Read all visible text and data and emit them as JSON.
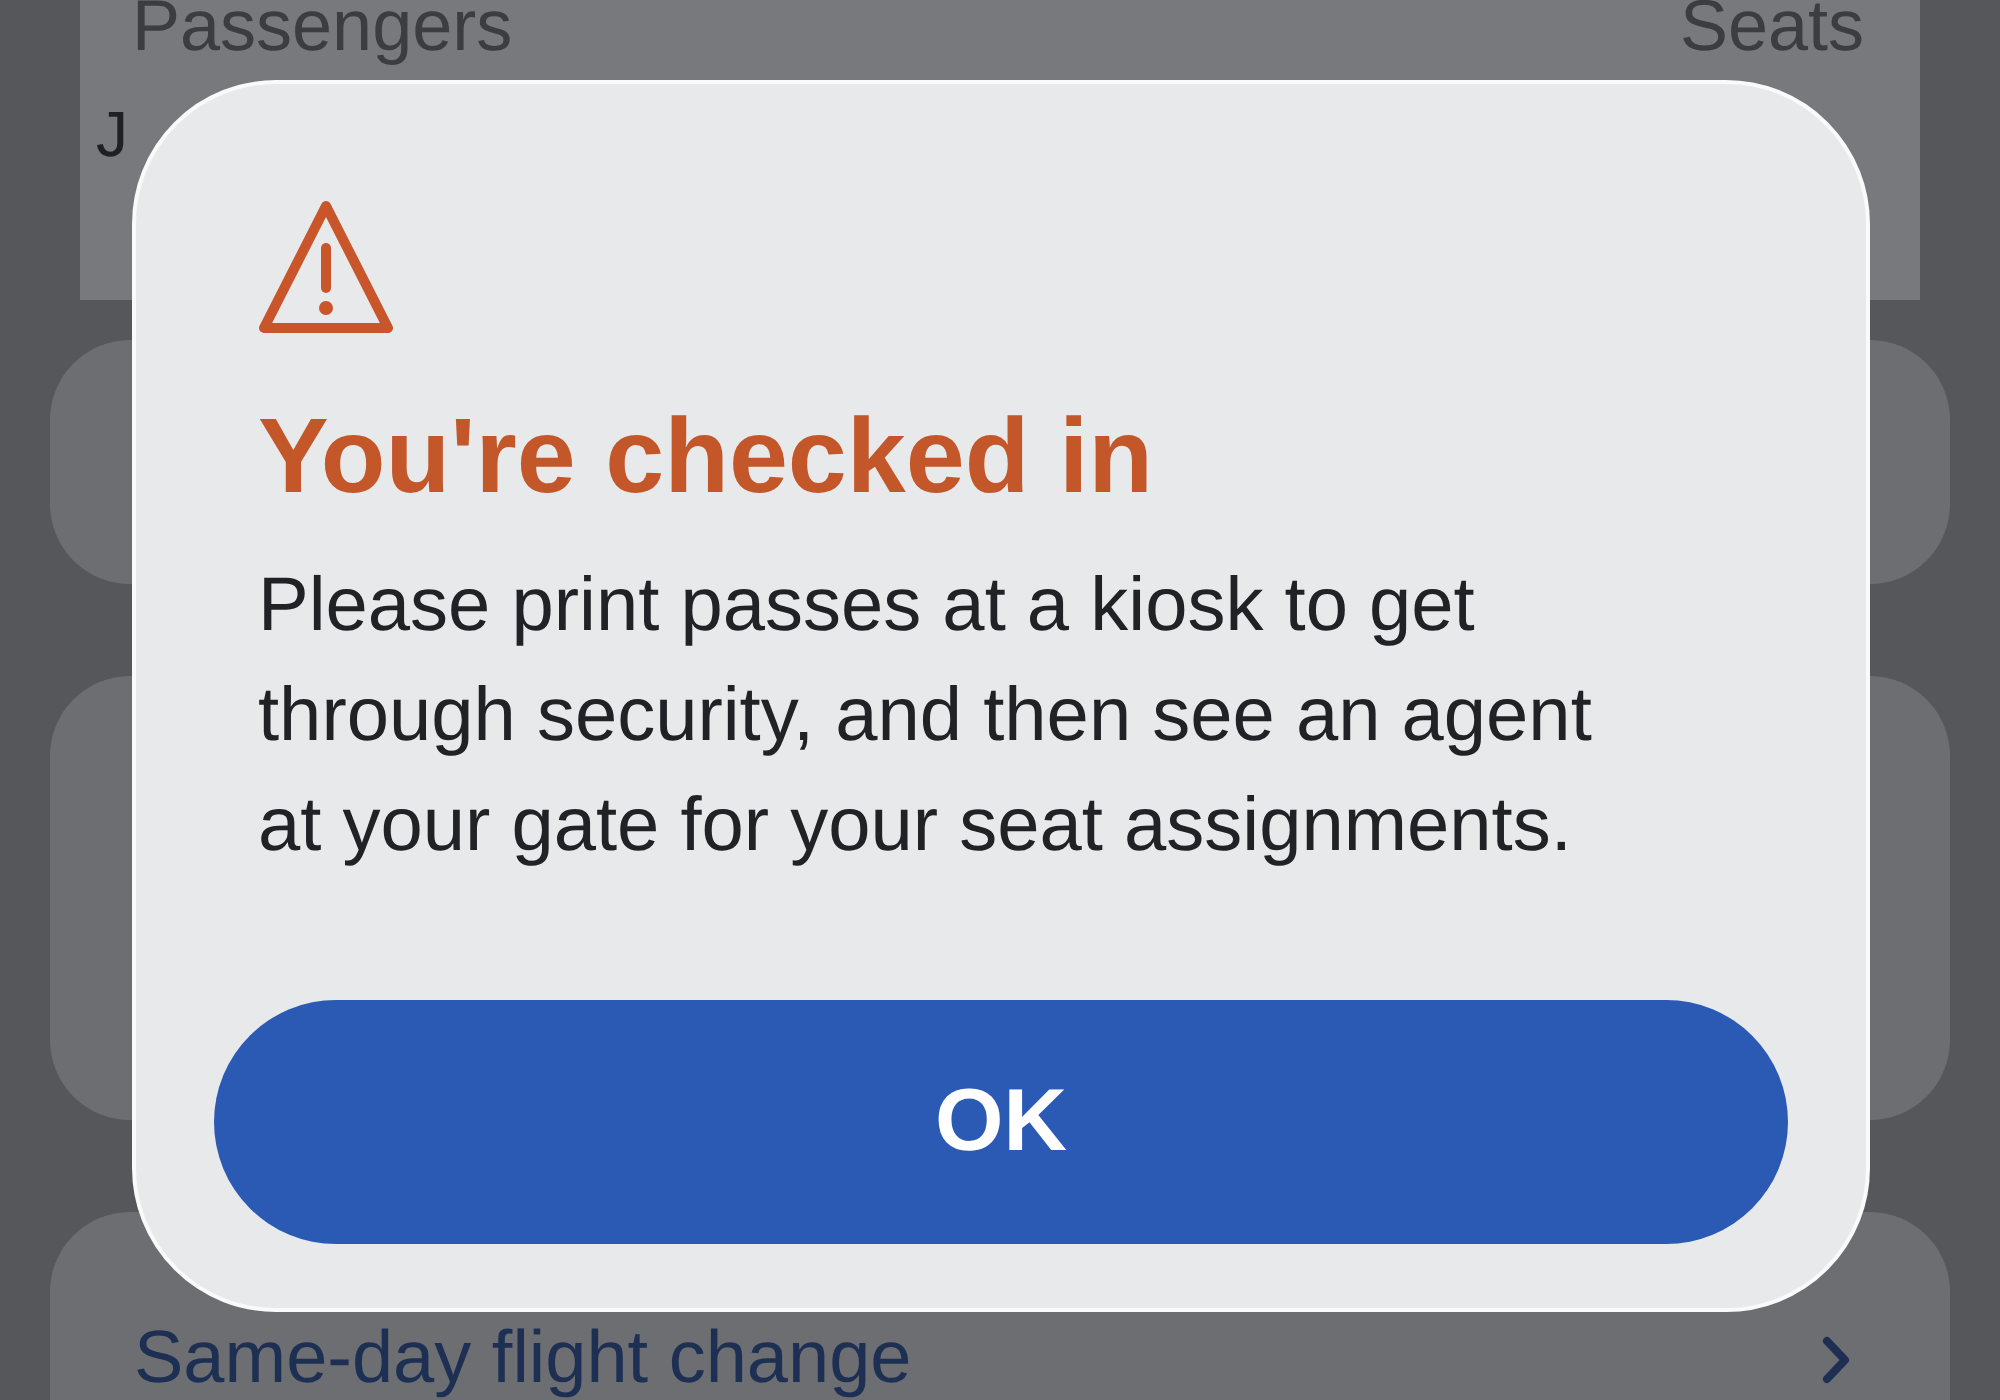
{
  "background": {
    "header": {
      "passengers": "Passengers",
      "seats": "Seats"
    },
    "passenger_name": "J",
    "list_item": {
      "label": "Same-day flight change"
    }
  },
  "alert": {
    "title": "You're checked in",
    "message": "Please print passes at a kiosk to get through security, and then see an agent at your gate for your seat assignments.",
    "button": "OK"
  }
}
